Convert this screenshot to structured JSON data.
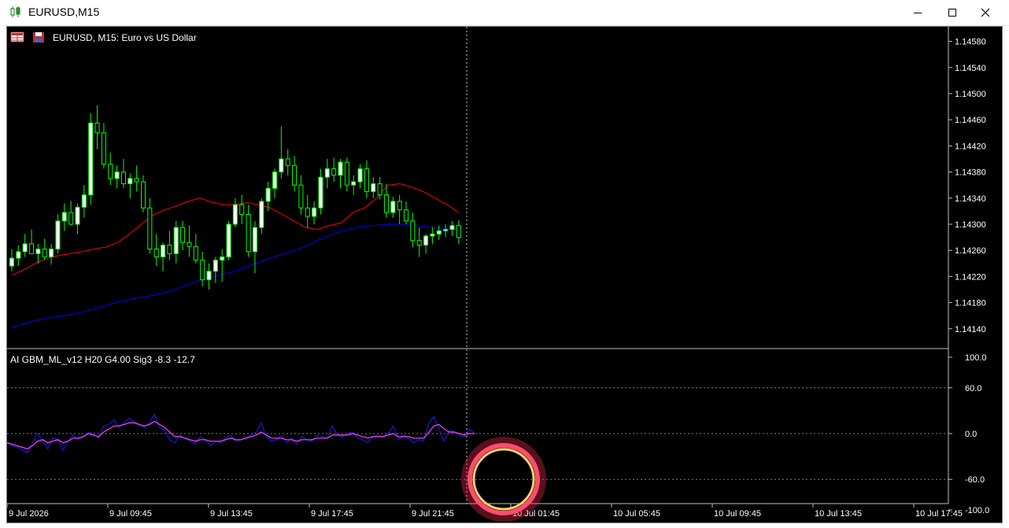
{
  "window": {
    "title": "EURUSD,M15",
    "app_icon": "candlestick-icon",
    "minimize_icon": "minimize-icon",
    "maximize_icon": "maximize-icon",
    "close_icon": "close-icon"
  },
  "chart": {
    "header": "EURUSD, M15:  Euro vs US Dollar",
    "header_icons": [
      "grid-table-icon",
      "save-icon"
    ],
    "indicator_label": "AI GBM_ML_v12 H20 G4.00 Sig3 -8.3 -12.7",
    "colors": {
      "background": "#000000",
      "bull_body": "#ffffff",
      "bear_body": "#000000",
      "candle_border": "#00ff00",
      "ma_fast": "#ff0000",
      "ma_slow": "#0000ff",
      "osc_main": "#1a1ad6",
      "osc_signal": "#ff40ff",
      "grid": "#808080",
      "cursor_ring": "#ff4d6d",
      "cursor_ring_inner": "#ffd36b"
    }
  },
  "chart_data": [
    {
      "type": "candlestick",
      "title": "EURUSD, M15:  Euro vs US Dollar",
      "ylim": [
        1.1411,
        1.1461
      ],
      "y_ticks": [
        "1.14580",
        "1.14540",
        "1.14500",
        "1.14460",
        "1.14420",
        "1.14380",
        "1.14340",
        "1.14300",
        "1.14260",
        "1.14220",
        "1.14180",
        "1.14140"
      ],
      "x_ticks": [
        "9 Jul 2026",
        "9 Jul 09:45",
        "9 Jul 13:45",
        "9 Jul 17:45",
        "9 Jul 21:45",
        "10 Jul 01:45",
        "10 Jul 05:45",
        "10 Jul 09:45",
        "10 Jul 13:45",
        "10 Jul 17:45"
      ],
      "candles": [
        [
          1.14236,
          1.14262,
          1.14228,
          1.14248
        ],
        [
          1.14248,
          1.14268,
          1.14236,
          1.14258
        ],
        [
          1.14258,
          1.14285,
          1.1425,
          1.1427
        ],
        [
          1.1427,
          1.14292,
          1.1426,
          1.14255
        ],
        [
          1.14255,
          1.1427,
          1.1424,
          1.14262
        ],
        [
          1.14262,
          1.14278,
          1.14245,
          1.1425
        ],
        [
          1.1425,
          1.1427,
          1.14238,
          1.14262
        ],
        [
          1.14262,
          1.14315,
          1.14255,
          1.14305
        ],
        [
          1.14305,
          1.14332,
          1.1429,
          1.14318
        ],
        [
          1.14318,
          1.14336,
          1.14298,
          1.143
        ],
        [
          1.143,
          1.14332,
          1.14285,
          1.14326
        ],
        [
          1.14326,
          1.1436,
          1.1431,
          1.14345
        ],
        [
          1.14345,
          1.1447,
          1.1433,
          1.14455
        ],
        [
          1.14455,
          1.14482,
          1.14415,
          1.1444
        ],
        [
          1.1444,
          1.14455,
          1.14385,
          1.14392
        ],
        [
          1.14392,
          1.1441,
          1.1436,
          1.1437
        ],
        [
          1.1437,
          1.1439,
          1.14355,
          1.1438
        ],
        [
          1.1438,
          1.144,
          1.14355,
          1.14362
        ],
        [
          1.14362,
          1.14378,
          1.1434,
          1.1437
        ],
        [
          1.1437,
          1.1439,
          1.1435,
          1.14365
        ],
        [
          1.14365,
          1.14375,
          1.14318,
          1.14325
        ],
        [
          1.14325,
          1.1434,
          1.14255,
          1.14262
        ],
        [
          1.14262,
          1.14285,
          1.14236,
          1.1425
        ],
        [
          1.1425,
          1.14272,
          1.14228,
          1.14268
        ],
        [
          1.14268,
          1.1429,
          1.14245,
          1.14255
        ],
        [
          1.14255,
          1.14305,
          1.1424,
          1.14295
        ],
        [
          1.14295,
          1.14305,
          1.1426,
          1.14272
        ],
        [
          1.14272,
          1.14298,
          1.1425,
          1.14266
        ],
        [
          1.14266,
          1.14285,
          1.1424,
          1.14245
        ],
        [
          1.14245,
          1.14258,
          1.14205,
          1.14215
        ],
        [
          1.14215,
          1.1424,
          1.142,
          1.14228
        ],
        [
          1.14228,
          1.1425,
          1.1421,
          1.14245
        ],
        [
          1.14245,
          1.14262,
          1.14212,
          1.1425
        ],
        [
          1.1425,
          1.14305,
          1.14245,
          1.143
        ],
        [
          1.143,
          1.1434,
          1.14295,
          1.1433
        ],
        [
          1.1433,
          1.14345,
          1.143,
          1.14315
        ],
        [
          1.14315,
          1.1433,
          1.1425,
          1.14258
        ],
        [
          1.14258,
          1.14305,
          1.14225,
          1.14295
        ],
        [
          1.14295,
          1.1434,
          1.14285,
          1.14335
        ],
        [
          1.14335,
          1.14365,
          1.1432,
          1.14355
        ],
        [
          1.14355,
          1.14385,
          1.1434,
          1.1438
        ],
        [
          1.1438,
          1.1445,
          1.1437,
          1.144
        ],
        [
          1.144,
          1.14415,
          1.14375,
          1.1439
        ],
        [
          1.1439,
          1.14405,
          1.1435,
          1.1436
        ],
        [
          1.1436,
          1.14375,
          1.14315,
          1.14325
        ],
        [
          1.14325,
          1.14345,
          1.14295,
          1.14312
        ],
        [
          1.14312,
          1.14335,
          1.143,
          1.14325
        ],
        [
          1.14325,
          1.14385,
          1.14315,
          1.14372
        ],
        [
          1.14372,
          1.144,
          1.14355,
          1.14385
        ],
        [
          1.14385,
          1.14402,
          1.14365,
          1.14375
        ],
        [
          1.14375,
          1.144,
          1.14355,
          1.14395
        ],
        [
          1.14395,
          1.14402,
          1.1435,
          1.1436
        ],
        [
          1.1436,
          1.14375,
          1.14345,
          1.14365
        ],
        [
          1.14365,
          1.14392,
          1.14355,
          1.14385
        ],
        [
          1.14385,
          1.14398,
          1.1434,
          1.1435
        ],
        [
          1.1435,
          1.14372,
          1.1434,
          1.14362
        ],
        [
          1.14362,
          1.14372,
          1.14338,
          1.14345
        ],
        [
          1.14345,
          1.14362,
          1.1431,
          1.14318
        ],
        [
          1.14318,
          1.14342,
          1.1431,
          1.14335
        ],
        [
          1.14335,
          1.14345,
          1.143,
          1.14322
        ],
        [
          1.14322,
          1.14335,
          1.143,
          1.14305
        ],
        [
          1.14305,
          1.14318,
          1.14265,
          1.14275
        ],
        [
          1.14275,
          1.14295,
          1.1425,
          1.14268
        ],
        [
          1.14268,
          1.14285,
          1.14255,
          1.14282
        ],
        [
          1.14282,
          1.14295,
          1.1427,
          1.14285
        ],
        [
          1.14285,
          1.14298,
          1.14276,
          1.1429
        ],
        [
          1.1429,
          1.143,
          1.1428,
          1.14292
        ],
        [
          1.14292,
          1.14305,
          1.14282,
          1.14298
        ],
        [
          1.14298,
          1.14306,
          1.1427,
          1.1428
        ]
      ],
      "ma_fast": [
        1.14222,
        1.1423,
        1.1424,
        1.14248,
        1.14252,
        1.14255,
        1.14258,
        1.14262,
        1.14265,
        1.14272,
        1.14285,
        1.143,
        1.14314,
        1.14322,
        1.14328,
        1.14335,
        1.1434,
        1.14334,
        1.1433,
        1.1433,
        1.14333,
        1.1433,
        1.14325,
        1.14315,
        1.14305,
        1.14295,
        1.14292,
        1.14298,
        1.14302,
        1.14318,
        1.14325,
        1.1434,
        1.1436,
        1.14362,
        1.14357,
        1.1435,
        1.1434,
        1.1433,
        1.14318
      ],
      "ma_slow": [
        1.14142,
        1.1415,
        1.14156,
        1.1416,
        1.14165,
        1.14172,
        1.1418,
        1.14186,
        1.1419,
        1.14196,
        1.14205,
        1.14215,
        1.14222,
        1.14228,
        1.14238,
        1.14248,
        1.14256,
        1.14265,
        1.14278,
        1.14288,
        1.14295,
        1.14298,
        1.143,
        1.143,
        1.14296,
        1.14294,
        1.14292
      ],
      "dates_note": ""
    },
    {
      "type": "line",
      "title": "AI GBM_ML_v12 H20 G4.00 Sig3 -8.3 -12.7",
      "ylim": [
        -100,
        100
      ],
      "y_ticks": [
        "100.0",
        "60.0",
        "0.0",
        "-60.0",
        "-100.0"
      ],
      "series": [
        {
          "name": "",
          "values": [
            -12,
            -16,
            -18,
            -22,
            -25,
            -12,
            0,
            -10,
            -20,
            -5,
            -8,
            -22,
            -10,
            -2,
            -8,
            -4,
            2,
            -1,
            -6,
            10,
            12,
            18,
            8,
            14,
            20,
            16,
            12,
            8,
            14,
            25,
            8,
            5,
            -8,
            -12,
            -2,
            -6,
            -10,
            -14,
            -4,
            -8,
            -16,
            -10,
            -12,
            -6,
            -2,
            -10,
            -8,
            -5,
            -2,
            2,
            14,
            -4,
            -10,
            -8,
            -3,
            -12,
            -6,
            -14,
            -4,
            -8,
            -10,
            -2,
            -4,
            -6,
            10,
            -2,
            -4,
            0,
            2,
            -6,
            -8,
            -12,
            -4,
            -2,
            -4,
            0,
            10,
            -8,
            -2,
            -6,
            -12,
            -8,
            -10,
            14,
            22,
            6,
            -10,
            4,
            2,
            -2,
            -4,
            6,
            0
          ]
        },
        {
          "name": "",
          "values": [
            -12,
            -14,
            -16,
            -18,
            -20,
            -16,
            -10,
            -8,
            -12,
            -10,
            -8,
            -12,
            -10,
            -6,
            -6,
            -4,
            0,
            -2,
            -4,
            2,
            6,
            10,
            10,
            12,
            14,
            14,
            12,
            10,
            12,
            16,
            12,
            8,
            2,
            -4,
            -4,
            -6,
            -8,
            -10,
            -8,
            -8,
            -10,
            -10,
            -10,
            -8,
            -6,
            -8,
            -8,
            -6,
            -4,
            -2,
            2,
            -2,
            -6,
            -6,
            -6,
            -8,
            -8,
            -10,
            -8,
            -8,
            -8,
            -6,
            -6,
            -6,
            -2,
            -2,
            -2,
            -2,
            0,
            -2,
            -4,
            -6,
            -4,
            -4,
            -4,
            -2,
            0,
            -4,
            -4,
            -4,
            -6,
            -6,
            -6,
            2,
            10,
            12,
            6,
            2,
            2,
            0,
            -2,
            0,
            0
          ]
        }
      ]
    }
  ]
}
